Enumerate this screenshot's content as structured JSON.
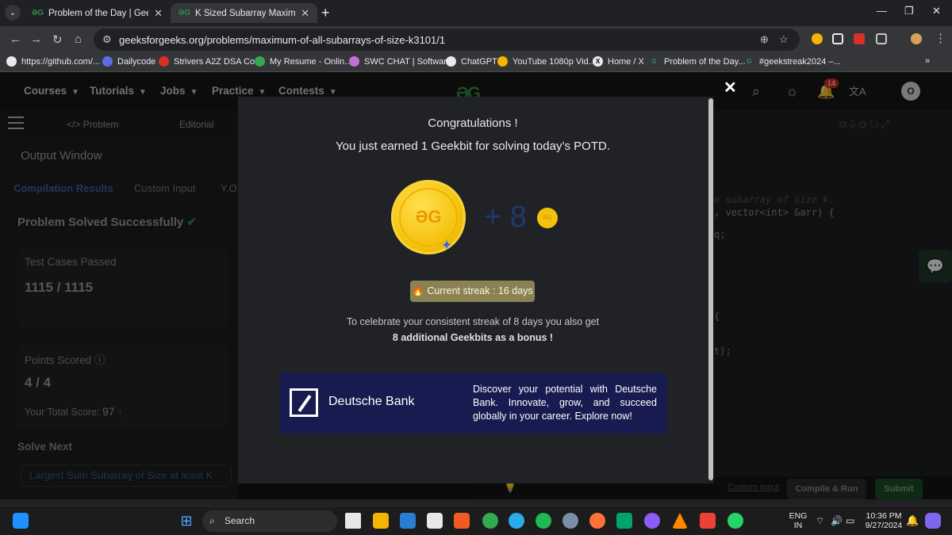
{
  "browser": {
    "tabs": [
      {
        "icon": "gfg-icon",
        "title": "Problem of the Day | GeeksforG",
        "active": false
      },
      {
        "icon": "gfg-icon",
        "title": "K Sized Subarray Maximum | Pr",
        "active": true
      }
    ],
    "url": "geeksforgeeks.org/problems/maximum-of-all-subarrays-of-size-k3101/1",
    "bookmarks": [
      {
        "label": "https://github.com/...",
        "color": "#e8eaed"
      },
      {
        "label": "Dailycode",
        "color": "#5b6ee1"
      },
      {
        "label": "Strivers A2Z DSA Co...",
        "color": "#d93025"
      },
      {
        "label": "My Resume - Onlin...",
        "color": "#34a853"
      },
      {
        "label": "SWC CHAT | Softwar...",
        "color": "#c26fd9"
      },
      {
        "label": "ChatGPT",
        "color": "#e8eaed"
      },
      {
        "label": "YouTube 1080p Vid...",
        "color": "#f4b400"
      },
      {
        "label": "Home / X",
        "color": "#e8eaed"
      },
      {
        "label": "Problem of the Day...",
        "color": "#2f8d46"
      },
      {
        "label": "#geekstreak2024 –...",
        "color": "#2f8d46"
      }
    ]
  },
  "gfg_nav": {
    "items": [
      "Courses",
      "Tutorials",
      "Jobs",
      "Practice",
      "Contests"
    ],
    "notification_count": "14",
    "avatar_letter": "O"
  },
  "subtabs": {
    "problem": "</> Problem",
    "editorial": "Editorial"
  },
  "output": {
    "title": "Output Window",
    "tabs": [
      "Compilation Results",
      "Custom Input",
      "Y.O."
    ],
    "solved_text": "Problem Solved Successfully",
    "test_cases_label": "Test Cases Passed",
    "test_cases_value": "1115 / 1115",
    "points_label": "Points Scored",
    "points_value": "4 / 4",
    "total_score_label": "Your Total Score:",
    "total_score_value": "97",
    "solve_next_label": "Solve Next",
    "next_problem": "Largest Sum Subarray of Size at least K"
  },
  "code_snippets": {
    "line1": "n subarray of size k.",
    "line2": ", vector<int> &arr) {",
    "line3": "q;",
    "line4": "{",
    "line5": "t);"
  },
  "editor_bar": {
    "custom_input": "Custom Input",
    "compile_run": "Compile & Run",
    "submit": "Submit"
  },
  "modal": {
    "congrats": "Congratulations !",
    "earned": "You just earned 1 Geekbit for solving today’s POTD.",
    "bonus_amount": "+ 8",
    "streak": "🔥 Current streak : 16 days",
    "celebrate": "To celebrate your consistent streak of 8 days you also get",
    "bonus": "8 additional Geekbits as a bonus !",
    "ad_brand": "Deutsche Bank",
    "ad_text": "Discover your potential with Deutsche Bank. Innovate, grow, and succeed globally in your career. Explore now!"
  },
  "taskbar": {
    "search": "Search",
    "lang_top": "ENG",
    "lang_bottom": "IN",
    "time": "10:36 PM",
    "date": "9/27/2024"
  }
}
